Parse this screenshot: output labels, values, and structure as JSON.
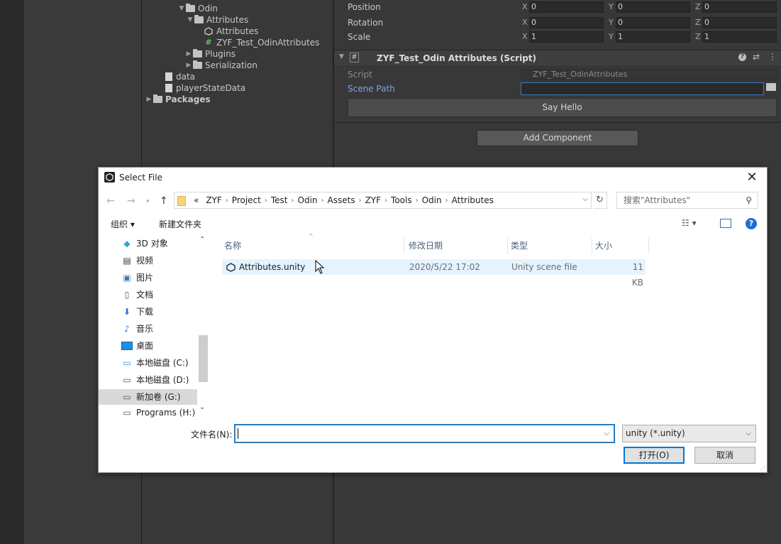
{
  "unity": {
    "project_tree": [
      {
        "label": "Odin",
        "type": "folder",
        "expanded": true
      },
      {
        "label": "Attributes",
        "type": "folder",
        "expanded": true
      },
      {
        "label": "Attributes",
        "type": "scene"
      },
      {
        "label": "ZYF_Test_OdinAttributes",
        "type": "script"
      },
      {
        "label": "Plugins",
        "type": "folder"
      },
      {
        "label": "Serialization",
        "type": "folder"
      },
      {
        "label": "data",
        "type": "file"
      },
      {
        "label": "playerStateData",
        "type": "file"
      },
      {
        "label": "Packages",
        "type": "folder"
      }
    ],
    "transform": {
      "position_label": "Position",
      "rotation_label": "Rotation",
      "scale_label": "Scale",
      "axes": [
        "X",
        "Y",
        "Z"
      ],
      "position": [
        "0",
        "0",
        "0"
      ],
      "rotation": [
        "0",
        "0",
        "0"
      ],
      "scale": [
        "1",
        "1",
        "1"
      ]
    },
    "component": {
      "title": "ZYF_Test_Odin Attributes (Script)",
      "script_label": "Script",
      "script_value": "ZYF_Test_OdinAttributes",
      "scene_path_label": "Scene Path",
      "scene_path_value": "",
      "say_hello_label": "Say Hello"
    },
    "add_component_label": "Add Component"
  },
  "dialog": {
    "title": "Select File",
    "breadcrumb": [
      "«",
      "ZYF",
      "Project",
      "Test",
      "Odin",
      "Assets",
      "ZYF",
      "Tools",
      "Odin",
      "Attributes"
    ],
    "search_placeholder": "搜索\"Attributes\"",
    "organize_label": "组织 ▾",
    "new_folder_label": "新建文件夹",
    "nav_items": [
      {
        "label": "3D 对象",
        "icon": "cube-icon"
      },
      {
        "label": "视频",
        "icon": "video-icon"
      },
      {
        "label": "图片",
        "icon": "pictures-icon"
      },
      {
        "label": "文档",
        "icon": "documents-icon"
      },
      {
        "label": "下载",
        "icon": "download-icon"
      },
      {
        "label": "音乐",
        "icon": "music-icon"
      },
      {
        "label": "桌面",
        "icon": "desktop-icon"
      },
      {
        "label": "本地磁盘 (C:)",
        "icon": "drive-c-icon"
      },
      {
        "label": "本地磁盘 (D:)",
        "icon": "drive-icon"
      },
      {
        "label": "新加卷 (G:)",
        "icon": "drive-icon",
        "selected": true
      },
      {
        "label": "Programs (H:)",
        "icon": "drive-icon"
      }
    ],
    "columns": {
      "name": "名称",
      "date": "修改日期",
      "type": "类型",
      "size": "大小"
    },
    "files": [
      {
        "name": "Attributes.unity",
        "date": "2020/5/22 17:02",
        "type": "Unity scene file",
        "size": "11 KB"
      }
    ],
    "filename_label": "文件名(N):",
    "filename_value": "",
    "filter_value": "unity (*.unity)",
    "open_label": "打开(O)",
    "cancel_label": "取消"
  }
}
